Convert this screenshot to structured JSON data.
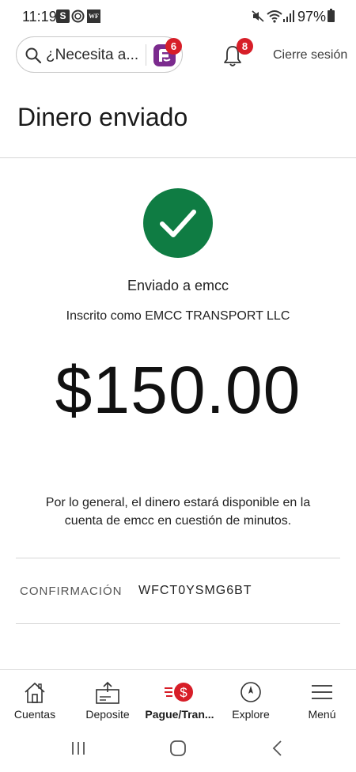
{
  "status_bar": {
    "time": "11:19",
    "battery": "97%",
    "icons": [
      "s-app-icon",
      "ring-icon",
      "wf-icon",
      "mute-icon",
      "wifi-icon",
      "signal-icon",
      "battery-icon"
    ]
  },
  "header": {
    "search_text": "¿Necesita a...",
    "fargo_badge": "6",
    "notification_badge": "8",
    "logout_label": "Cierre sesión"
  },
  "page": {
    "title": "Dinero enviado"
  },
  "confirmation": {
    "sent_to": "Enviado a emcc",
    "enrolled_as": "Inscrito como EMCC TRANSPORT LLC",
    "amount": "$150.00",
    "availability": "Por lo general, el dinero estará disponible en la cuenta de emcc en cuestión de minutos.",
    "label": "CONFIRMACIÓN",
    "code": "WFCT0YSMG6BT"
  },
  "bottom_nav": {
    "items": [
      {
        "label": "Cuentas",
        "icon": "house-icon"
      },
      {
        "label": "Deposite",
        "icon": "deposit-icon"
      },
      {
        "label": "Pague/Tran...",
        "icon": "pay-transfer-icon",
        "active": true
      },
      {
        "label": "Explore",
        "icon": "compass-icon"
      },
      {
        "label": "Menú",
        "icon": "hamburger-icon"
      }
    ]
  },
  "colors": {
    "success_green": "#0f7c43",
    "badge_red": "#d71e28",
    "fargo_purple": "#7b2b8e"
  }
}
